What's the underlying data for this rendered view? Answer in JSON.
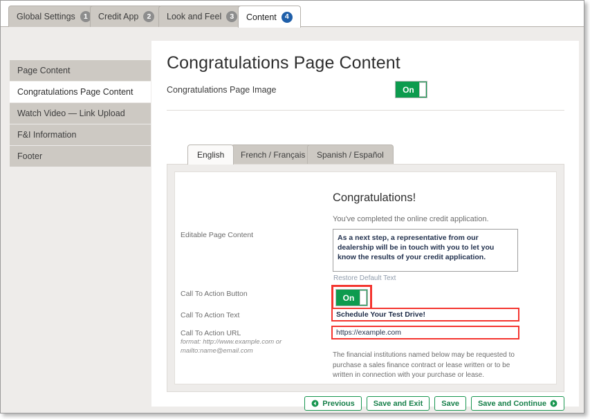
{
  "top_tabs": [
    {
      "label": "Global Settings",
      "badge": "1",
      "active": false
    },
    {
      "label": "Credit App",
      "badge": "2",
      "active": false
    },
    {
      "label": "Look and Feel",
      "badge": "3",
      "active": false
    },
    {
      "label": "Content",
      "badge": "4",
      "active": true
    }
  ],
  "sidebar": {
    "items": [
      {
        "label": "Page Content",
        "active": false
      },
      {
        "label": "Congratulations Page Content",
        "active": true
      },
      {
        "label": "Watch Video — Link Upload",
        "active": false
      },
      {
        "label": "F&I Information",
        "active": false
      },
      {
        "label": "Footer",
        "active": false
      }
    ]
  },
  "main": {
    "title": "Congratulations Page Content",
    "image_toggle": {
      "label": "Congratulations Page Image",
      "state": "On"
    },
    "language_tabs": [
      {
        "label": "English",
        "active": true
      },
      {
        "label": "French / Français",
        "active": false
      },
      {
        "label": "Spanish / Español",
        "active": false
      }
    ],
    "preview": {
      "heading": "Congratulations!",
      "subheading": "You've completed the online credit application.",
      "disclaimer": "The financial institutions named below may be requested to purchase a sales finance contract or lease written or to be written in connection with your purchase or lease."
    },
    "fields": {
      "editable_page_content": {
        "label": "Editable Page Content",
        "value": "As a next step, a representative from our dealership will be in touch with you to let you know the results of your credit application.",
        "restore_link": "Restore Default Text"
      },
      "cta_button": {
        "label": "Call To Action Button",
        "state": "On"
      },
      "cta_text": {
        "label": "Call To Action Text",
        "value": "Schedule Your Test Drive!"
      },
      "cta_url": {
        "label": "Call To Action URL",
        "hint": "format: http://www.example.com or mailto:name@email.com",
        "value": "https://example.com"
      }
    },
    "footer_buttons": [
      {
        "label": "Previous",
        "icon": "circle-left-arrow-icon",
        "icon_side": "left"
      },
      {
        "label": "Save and Exit",
        "icon": null,
        "icon_side": null
      },
      {
        "label": "Save",
        "icon": null,
        "icon_side": null
      },
      {
        "label": "Save and Continue",
        "icon": "circle-right-arrow-icon",
        "icon_side": "right"
      }
    ]
  },
  "colors": {
    "toggle_on": "#0d9b4e",
    "highlight": "#f4342e",
    "active_badge": "#1f5fa9",
    "button_green": "#17964f"
  }
}
